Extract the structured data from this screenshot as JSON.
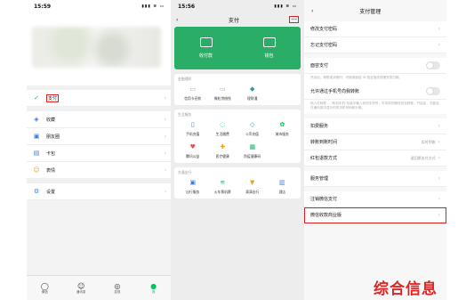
{
  "panel1": {
    "status_time": "15:59",
    "status_icons": "▮▮▮ ≋ ▭",
    "menu": [
      {
        "label": "支付",
        "icon": "pay-icon",
        "glyph": "✓",
        "color": "#07c160"
      },
      {
        "label": "收藏",
        "icon": "favorites-icon",
        "glyph": "◈",
        "color": "#3b7cd6"
      },
      {
        "label": "朋友圈",
        "icon": "moments-icon",
        "glyph": "▣",
        "color": "#3b7cd6"
      },
      {
        "label": "卡包",
        "icon": "card-wallet-icon",
        "glyph": "▤",
        "color": "#3b7cd6"
      },
      {
        "label": "表情",
        "icon": "sticker-icon",
        "glyph": "☺",
        "color": "#f0a020"
      },
      {
        "label": "设置",
        "icon": "settings-icon",
        "glyph": "⚙",
        "color": "#3b7cd6"
      }
    ],
    "tabs": [
      {
        "label": "微信",
        "icon": "chat-icon",
        "glyph": "◯"
      },
      {
        "label": "通讯录",
        "icon": "contacts-icon",
        "glyph": "☺"
      },
      {
        "label": "发现",
        "icon": "discover-icon",
        "glyph": "◎"
      },
      {
        "label": "我",
        "icon": "me-icon",
        "glyph": "●"
      }
    ]
  },
  "panel2": {
    "status_time": "15:56",
    "title": "支付",
    "more": "···",
    "green": [
      {
        "label": "收付款"
      },
      {
        "label": "钱包"
      }
    ],
    "sections": [
      {
        "title": "金融理财",
        "items": [
          {
            "label": "信用卡还款",
            "glyph": "▭",
            "color": "#f0a020"
          },
          {
            "label": "微粒贷借钱",
            "glyph": "▭",
            "color": "#f0a020"
          },
          {
            "label": "理财通",
            "glyph": "◆",
            "color": "#20a0a0"
          }
        ]
      },
      {
        "title": "生活服务",
        "items": [
          {
            "label": "手机充值",
            "glyph": "▯",
            "color": "#3b7cd6"
          },
          {
            "label": "生活缴费",
            "glyph": "◌",
            "color": "#07c160"
          },
          {
            "label": "Q币充值",
            "glyph": "◇",
            "color": "#3b7cd6"
          },
          {
            "label": "城市服务",
            "glyph": "✿",
            "color": "#07c160"
          },
          {
            "label": "腾讯公益",
            "glyph": "♥",
            "color": "#e05050"
          },
          {
            "label": "医疗健康",
            "glyph": "✚",
            "color": "#f0a020"
          },
          {
            "label": "防疫健康码",
            "glyph": "▦",
            "color": "#07c160"
          }
        ]
      },
      {
        "title": "交通出行",
        "items": [
          {
            "label": "出行服务",
            "glyph": "▣",
            "color": "#3b7cd6"
          },
          {
            "label": "火车票机票",
            "glyph": "≋",
            "color": "#07c160"
          },
          {
            "label": "滴滴出行",
            "glyph": "▼",
            "color": "#f0a020"
          },
          {
            "label": "酒店",
            "glyph": "▥",
            "color": "#3b7cd6"
          }
        ]
      }
    ]
  },
  "panel3": {
    "title": "支付管理",
    "rows": [
      {
        "label": "修改支付密码",
        "type": "link"
      },
      {
        "label": "忘记支付密码",
        "type": "link"
      },
      {
        "label": "面容支付",
        "type": "toggle",
        "note": "开启后，转账或消费时，可使用面容 ID 验证指纹快速完成付款。"
      },
      {
        "label": "允许通过手机号向我转账",
        "type": "toggle",
        "note": "他人在转账 -- \"转到手机\"功能中输入你的手机号，可向你的微信钱包转账。开启后，可能会在通讯录中显示你的手机号码和头像。"
      },
      {
        "label": "扣费服务",
        "type": "link"
      },
      {
        "label": "转账到账时间",
        "type": "link",
        "value": "实时到账"
      },
      {
        "label": "红包退款方式",
        "type": "link",
        "value": "退回原支付方式"
      },
      {
        "label": "服务管理",
        "type": "link"
      },
      {
        "label": "注销微信支付",
        "type": "link"
      },
      {
        "label": "微信收款商业版",
        "type": "link"
      }
    ]
  },
  "watermark": "综合信息"
}
